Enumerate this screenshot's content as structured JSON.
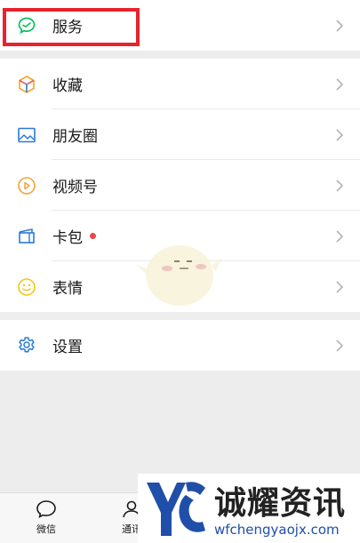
{
  "menu_groups": [
    {
      "items": [
        {
          "id": "services",
          "label": "服务",
          "icon": "services-icon"
        }
      ]
    },
    {
      "items": [
        {
          "id": "favorites",
          "label": "收藏",
          "icon": "favorites-cube-icon"
        },
        {
          "id": "moments",
          "label": "朋友圈",
          "icon": "moments-image-icon"
        },
        {
          "id": "channels",
          "label": "视频号",
          "icon": "channels-play-icon"
        },
        {
          "id": "cards",
          "label": "卡包",
          "icon": "wallet-card-icon",
          "badge": "red-dot"
        },
        {
          "id": "stickers",
          "label": "表情",
          "icon": "sticker-smile-icon"
        }
      ]
    },
    {
      "items": [
        {
          "id": "settings",
          "label": "设置",
          "icon": "settings-gear-icon"
        }
      ]
    }
  ],
  "tabbar": {
    "tabs": [
      {
        "label": "微信",
        "icon": "chat-bubble-icon"
      },
      {
        "label": "通讯",
        "icon": "contacts-person-icon"
      }
    ]
  },
  "watermark": {
    "title": "诚耀资讯",
    "url": "wfchengyaojx.com"
  },
  "colors": {
    "highlight": "#e8232e",
    "services_green": "#07c160",
    "favorites_orange": "#f5a623",
    "moments_blue": "#2a7ad5",
    "channels_orange": "#f0a43a",
    "cards_blue": "#2a7ad5",
    "stickers_yellow": "#f5c518",
    "settings_blue": "#2a7ad5",
    "watermark_blue": "#1f4fa8"
  }
}
